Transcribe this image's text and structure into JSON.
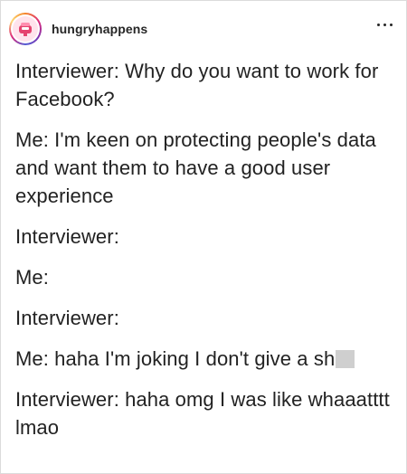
{
  "post": {
    "username": "hungryhappens",
    "more_icon": "more-horizontal-icon",
    "avatar_icon": "hungryhappens-logo"
  },
  "lines": [
    "Interviewer: Why do you want to work for Facebook?",
    "Me: I'm keen on protecting people's data and want them to have a good user experience",
    "Interviewer:",
    "Me:",
    "Interviewer:",
    "Me: haha I'm joking I don't give a sh",
    "Interviewer: haha omg I was like whaaatttt lmao"
  ],
  "colors": {
    "text": "#222222",
    "censor_block": "#cfcfcf",
    "avatar_bg": "#ffe3ec",
    "avatar_accent": "#e5436f"
  }
}
